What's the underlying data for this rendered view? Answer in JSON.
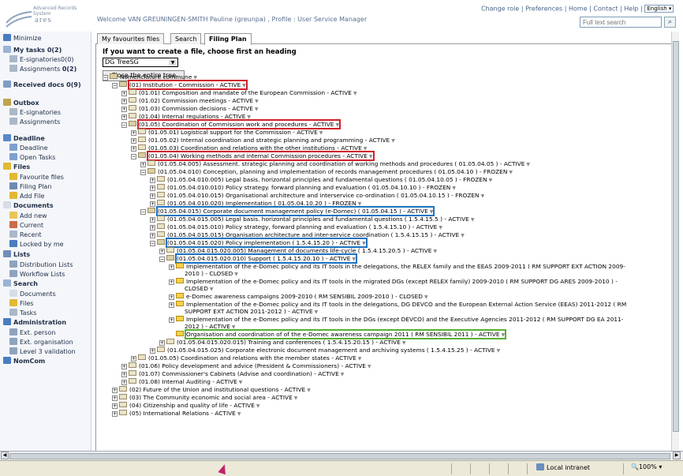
{
  "header": {
    "logo_subtitle": "Advanced Records System",
    "logo_name": "ares",
    "welcome": "Welcome VAN GREUNINGEN-SMITH Pauline (greunpa) , Profile : User Service Manager",
    "links": [
      "Change role",
      "Preferences",
      "Home",
      "Contact",
      "Help"
    ],
    "language": "English",
    "search_placeholder": "Full text search"
  },
  "sidebar": {
    "minimize": "Minimize",
    "my_tasks": "My tasks",
    "my_tasks_count": "0(2)",
    "e_signatories": "E-signatories",
    "e_signatories_count": "0(0)",
    "assignments": "Assignments",
    "assignments_count": "0(2)",
    "received_docs": "Received docs",
    "received_docs_count": "0(9)",
    "outbox": "Outbox",
    "outbox_e_signatories": "E-signatories",
    "outbox_assignments": "Assignments",
    "deadline": "Deadline",
    "deadline_item": "Deadline",
    "open_tasks": "Open Tasks",
    "files": "Files",
    "favourite_files": "Favourite files",
    "filing_plan": "Filing Plan",
    "add_file": "Add File",
    "documents": "Documents",
    "add_new": "Add new",
    "current": "Current",
    "recent": "Recent",
    "locked_by_me": "Locked by me",
    "lists": "Lists",
    "distribution_lists": "Distribution Lists",
    "workflow_lists": "Workflow Lists",
    "search": "Search",
    "search_documents": "Documents",
    "search_files": "Files",
    "search_tasks": "Tasks",
    "administration": "Administration",
    "ext_person": "Ext. person",
    "ext_organisation": "Ext. organisation",
    "level3": "Level 3 validation",
    "nomcom": "NomCom"
  },
  "tabs": [
    "My favourites files",
    "Search",
    "Filing Plan"
  ],
  "active_tab": "Filing Plan",
  "panel": {
    "heading": "If you want to create a file, choose first an heading",
    "select_value": "DG TreeSG",
    "close_button": "Close the entire tree"
  },
  "tree": [
    "Nomenclature commune",
    "(01) Institution - Commission - ACTIVE",
    "(01.01) Composition and mandate of the European Commission - ACTIVE",
    "(01.02) Commission meetings - ACTIVE",
    "(01.03) Commission decisions - ACTIVE",
    "(01.04) Internal regulations - ACTIVE",
    "(01.05) Coordination of Commission work and procedures - ACTIVE",
    "(01.05.01) Logistical support for the Commission - ACTIVE",
    "(01.05.02) Internal coordination and strategic planning and programming - ACTIVE",
    "(01.05.03) Coordination and relations with the other institutions - ACTIVE",
    "(01.05.04) Working methods and internal Commission procedures - ACTIVE",
    "(01.05.04.005) Assessment. strategic planning and coordination of working methods and procedures ( 01.05.04.05 ) - ACTIVE",
    "(01.05.04.010) Conception, planning and implementation of records management procedures ( 01.05.04.10 ) - FROZEN",
    "(01.05.04.010.005) Legal basis. horizontal principles and fundamental questions ( 01.05.04.10.05 ) - FROZEN",
    "(01.05.04.010.010) Policy strategy. forward planning and evaluation ( 01.05.04.10.10 ) - FROZEN",
    "(01.05.04.010.015) Organisational architecture and interservice co-ordination ( 01.05.04.10.15 ) - FROZEN",
    "(01.05.04.010.020) Implementation ( 01.05.04.10.20 ) - FROZEN",
    "(01.05.04.015) Corporate document management policy (e-Domec) ( 01.05.04.15 ) - ACTIVE",
    "(01.05.04.015.005) Legal basis. horizontal principles and fundamental questions ( 1.5.4.15.5 ) - ACTIVE",
    "(01.05.04.015.010) Policy strategy, forward planning and evaluation ( 1.5.4.15.10 ) - ACTIVE",
    "(01.05.04.015.015) Organisation architecture and inter-service coordination ( 1.5.4.15.15 ) - ACTIVE",
    "(01.05.04.015.020) Policy implementation ( 1.5.4.15.20 ) - ACTIVE",
    "(01.05.04.015.020.005) Management of documents life-cycle ( 1.5.4.15.20.5 ) - ACTIVE",
    "(01.05.04.015.020.010) Support ( 1.5.4.15.20.10 ) - ACTIVE",
    "Implementation of the e-Domec policy and its IT tools in the delegations, the RELEX family and the EEAS 2009-2011 ( RM SUPPORT EXT ACTION 2009-",
    "2010 ) - CLOSED",
    "Implementation of the e-Domec policy and its IT tools in the migrated DGs (except RELEX family) 2009-2010 ( RM SUPPORT DG ARES 2009-2010 ) -",
    "CLOSED",
    "e-Domec awareness campaigns 2009-2010 ( RM SENSIBIL 2009-2010 ) - CLOSED",
    "Implementation of the e-Domec policy and its IT tools in the delegations, DG DEVCO and the European External Action Service (EEAS) 2011-2012 ( RM",
    "SUPPORT EXT ACTION 2011-2012 ) - ACTIVE",
    "Implementation of the e-Domec policy and its IT tools in the DGs (except DEVCO) and the Executive Agencies 2011-2012 ( RM SUPPORT DG EA 2011-",
    "2012 ) - ACTIVE",
    "Organisation and coordination of of the e-Domec awareness campaign 2011 ( RM SENSIBIL 2011 ) - ACTIVE",
    "(01.05.04.015.020.015) Training and conferences ( 1.5.4.15.20.15 ) - ACTIVE",
    "(01.05.04.015.025) Corporate electronic document management and archiving systems ( 1.5.4.15.25 ) - ACTIVE",
    "(01.05.05) Coordination and relations with the member states - ACTIVE",
    "(01.06) Policy development and advice (President & Commissioners) - ACTIVE",
    "(01.07) Commissioner's Cabinets (Advise and coordination) - ACTIVE",
    "(01.08) Internal Auditing - ACTIVE",
    "(02) Future of the Union and institutional questions - ACTIVE",
    "(03) The Community economic and social area - ACTIVE",
    "(04) Citizenship and quality of life - ACTIVE",
    "(05) International Relations - ACTIVE"
  ],
  "status": {
    "zone": "Local intranet",
    "zoom": "100%"
  }
}
